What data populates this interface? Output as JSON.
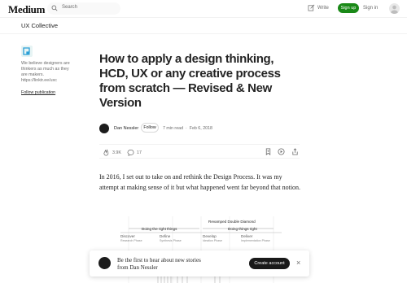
{
  "header": {
    "logo": "Medium",
    "search_placeholder": "Search",
    "write_label": "Write",
    "signup_label": "Sign up",
    "signin_label": "Sign in"
  },
  "publication": {
    "name": "UX Collective",
    "description": "We believe designers are thinkers as much as they are makers.",
    "link": "https://linktr.ee/uxc",
    "follow_label": "Follow publication"
  },
  "article": {
    "title": "How to apply a design thinking, HCD, UX or any creative process from scratch — Revised & New Version",
    "author": "Dan Nessler",
    "follow_label": "Follow",
    "read_time": "7 min read",
    "separator": "·",
    "date": "Feb 6, 2018",
    "claps": "3.9K",
    "comments": "17",
    "paragraph": "In 2016, I set out to take on and rethink the Design Process. It was my attempt at making sense of it but what happened went far beyond that notion."
  },
  "diagram": {
    "title": "Revamped Double Diamond",
    "left_label": "Doing the right things",
    "right_label": "Doing things right",
    "phases": [
      "Discover",
      "Define",
      "Develop",
      "Deliver"
    ],
    "sub": [
      "Research Phase",
      "Synthesis Phase",
      "Ideation Phase",
      "Implementation Phase"
    ]
  },
  "banner": {
    "text": "Be the first to hear about new stories from Dan Nessler",
    "button": "Create account",
    "close": "×"
  },
  "colors": {
    "brand_green": "#1a8917",
    "dark_button": "#191919",
    "muted_text": "#6b6b6b"
  }
}
